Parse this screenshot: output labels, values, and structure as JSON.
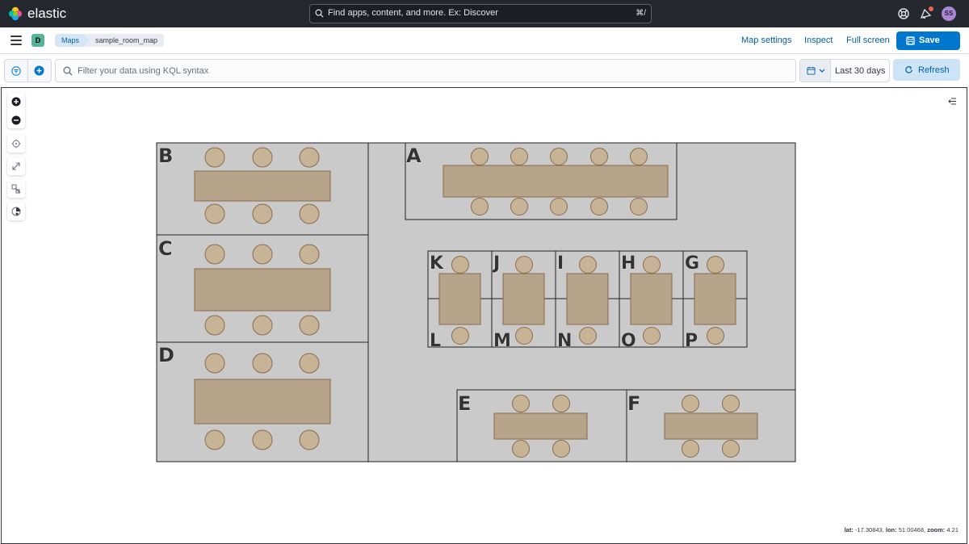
{
  "header": {
    "brand": "elastic",
    "search_placeholder": "Find apps, content, and more. Ex: Discover",
    "search_shortcut": "⌘/",
    "avatar_initials": "SS"
  },
  "nav": {
    "space_initial": "D",
    "breadcrumbs": [
      "Maps",
      "sample_room_map"
    ],
    "links": [
      "Map settings",
      "Inspect",
      "Full screen"
    ],
    "save_label": "Save"
  },
  "query": {
    "placeholder": "Filter your data using KQL syntax",
    "date_range": "Last 30 days",
    "refresh_label": "Refresh"
  },
  "map": {
    "controls": [
      "zoom-in-icon",
      "zoom-out-icon",
      "set-view-icon",
      "fit-to-data-icon",
      "draw-filter-icon",
      "draw-distance-icon"
    ],
    "coords": {
      "lat_label": "lat:",
      "lat": "-17.30843",
      "lon_label": "lon:",
      "lon": "51.00468",
      "zoom_label": "zoom:",
      "zoom": "4.21"
    },
    "room_labels": [
      "A",
      "B",
      "C",
      "D",
      "E",
      "F",
      "G",
      "H",
      "I",
      "J",
      "K",
      "L",
      "M",
      "N",
      "O",
      "P"
    ],
    "colors": {
      "floor": "#cacaca",
      "table": "#b5a48a",
      "chair": "#c7b497",
      "chair_stroke": "#8b6a4c",
      "wall": "#222222"
    }
  }
}
